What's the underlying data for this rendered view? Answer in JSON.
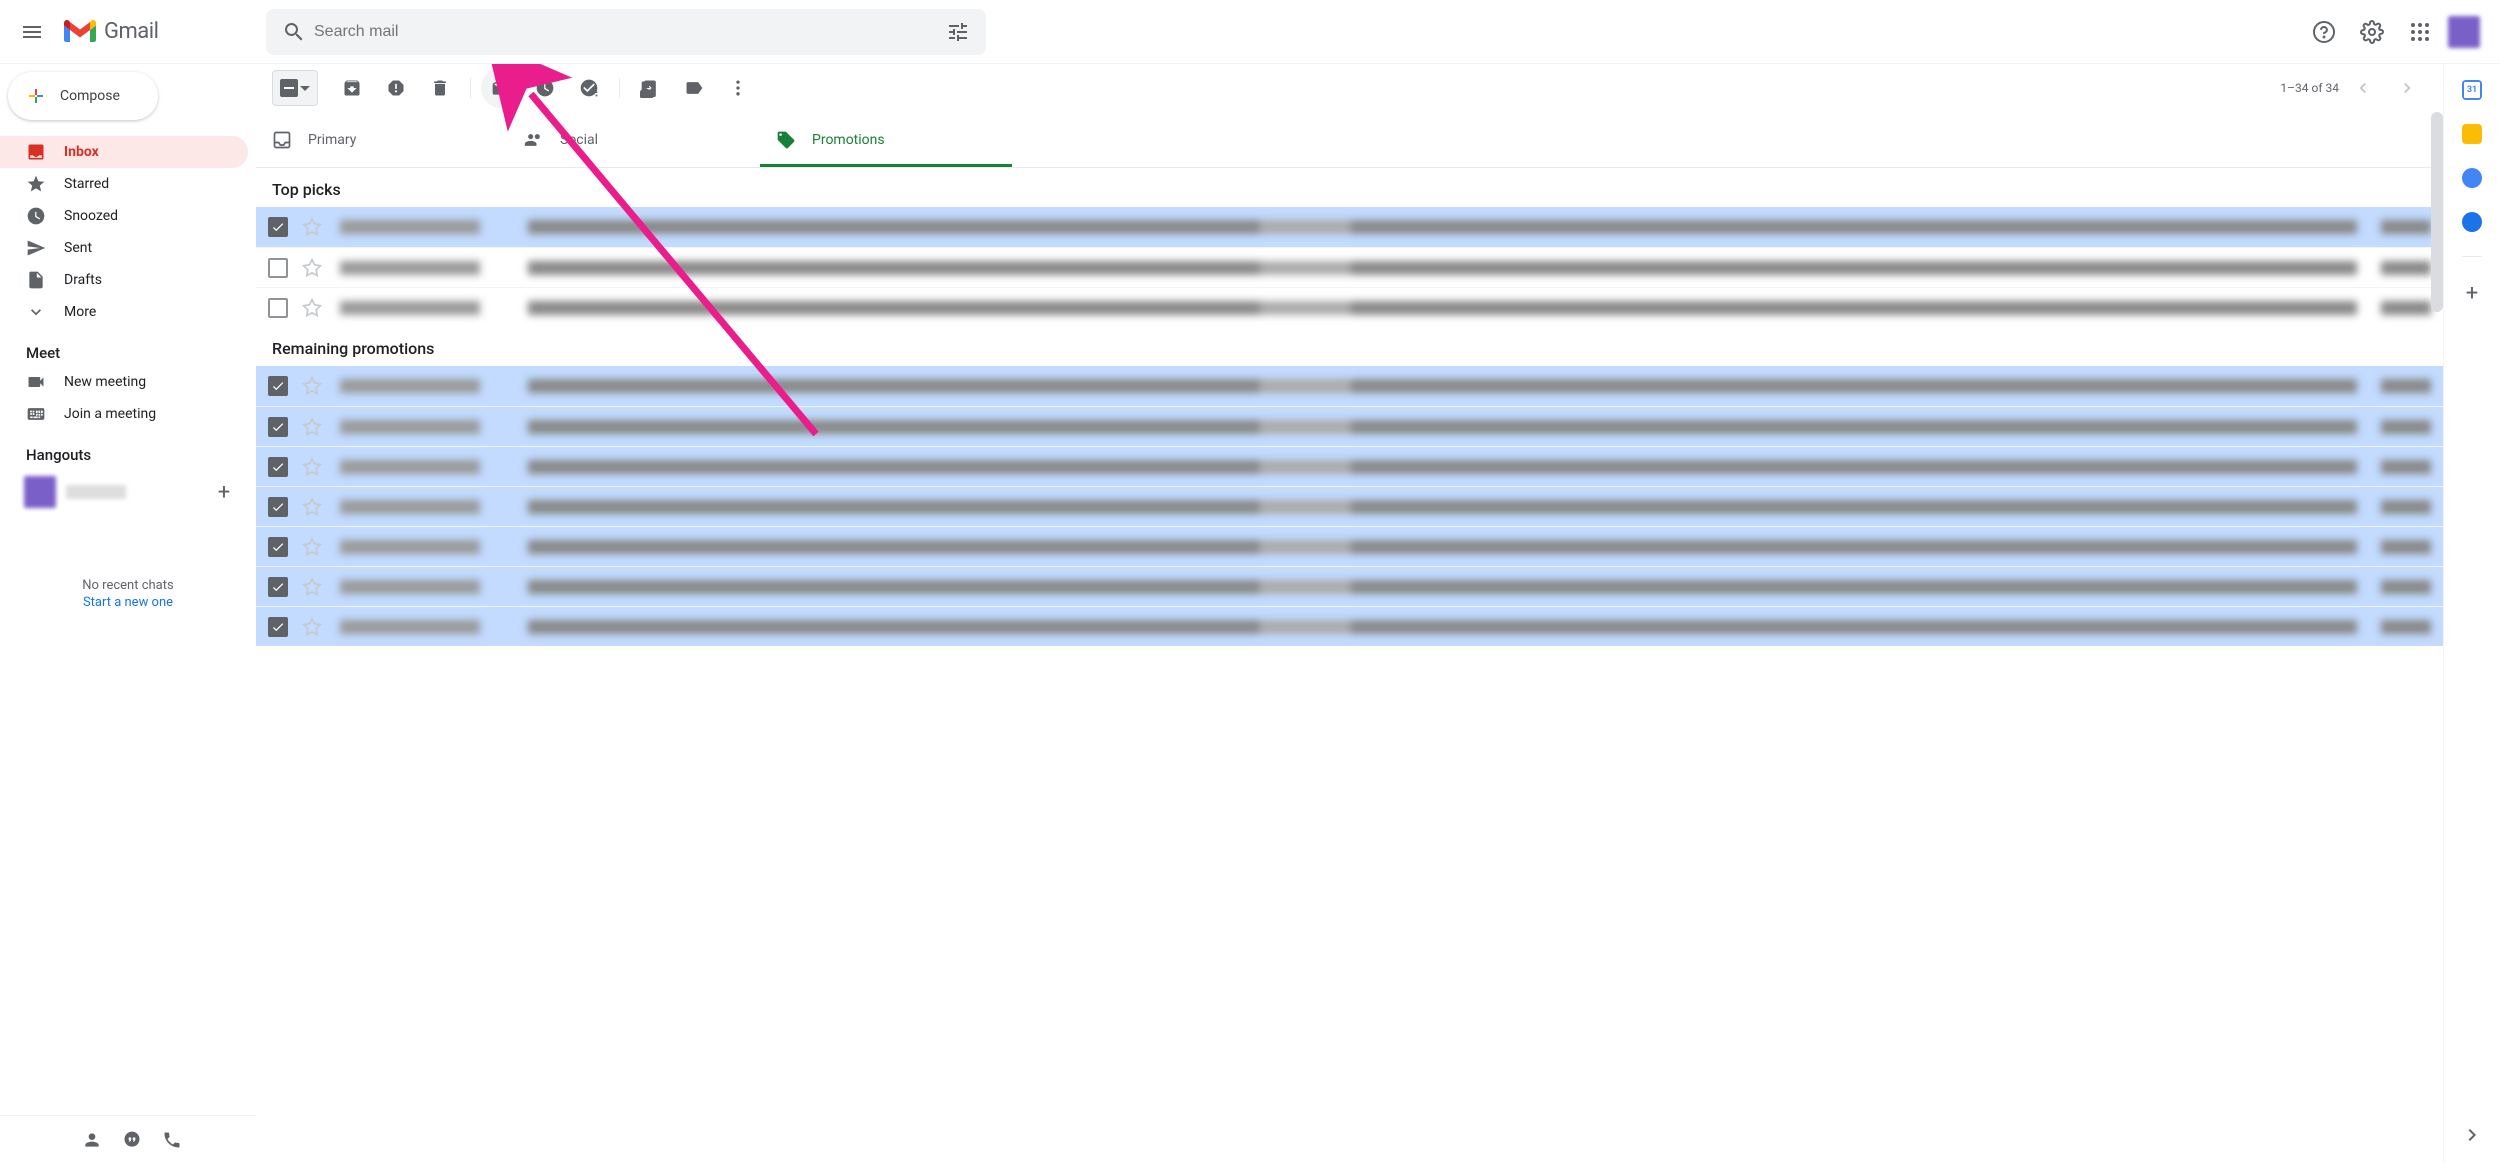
{
  "header": {
    "logo_text": "Gmail",
    "search_placeholder": "Search mail"
  },
  "compose_label": "Compose",
  "nav": [
    {
      "icon": "inbox",
      "label": "Inbox",
      "active": true
    },
    {
      "icon": "star",
      "label": "Starred"
    },
    {
      "icon": "clock",
      "label": "Snoozed"
    },
    {
      "icon": "send",
      "label": "Sent"
    },
    {
      "icon": "file",
      "label": "Drafts"
    },
    {
      "icon": "expand",
      "label": "More"
    }
  ],
  "meet": {
    "title": "Meet",
    "items": [
      {
        "icon": "video",
        "label": "New meeting"
      },
      {
        "icon": "keyboard",
        "label": "Join a meeting"
      }
    ]
  },
  "hangouts": {
    "title": "Hangouts",
    "no_chats": "No recent chats",
    "start_new": "Start a new one"
  },
  "pagination": "1–34 of 34",
  "tabs": [
    {
      "icon": "inbox-outline",
      "label": "Primary"
    },
    {
      "icon": "people",
      "label": "Social"
    },
    {
      "icon": "tag",
      "label": "Promotions",
      "active": true
    }
  ],
  "sections": [
    {
      "title": "Top picks",
      "rows": [
        {
          "checked": true,
          "selected": true
        },
        {
          "checked": false,
          "selected": false
        },
        {
          "checked": false,
          "selected": false
        }
      ]
    },
    {
      "title": "Remaining promotions",
      "rows": [
        {
          "checked": true,
          "selected": true
        },
        {
          "checked": true,
          "selected": true
        },
        {
          "checked": true,
          "selected": true
        },
        {
          "checked": true,
          "selected": true
        },
        {
          "checked": true,
          "selected": true
        },
        {
          "checked": true,
          "selected": true
        },
        {
          "checked": true,
          "selected": true
        }
      ]
    }
  ]
}
